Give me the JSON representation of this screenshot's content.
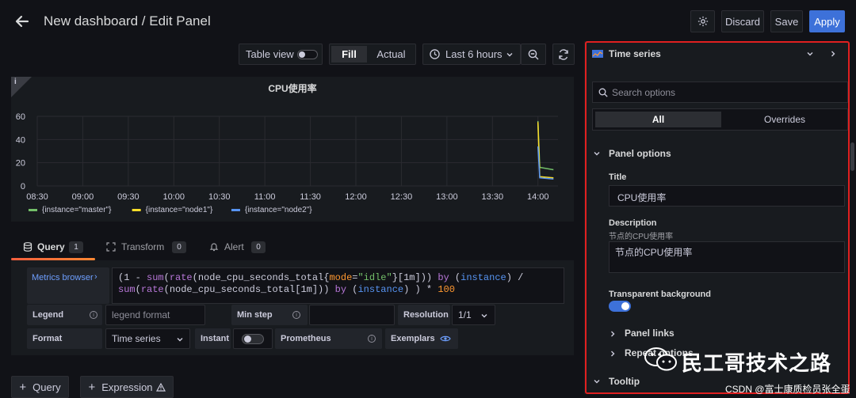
{
  "header": {
    "title": "New dashboard / Edit Panel",
    "discard": "Discard",
    "save": "Save",
    "apply": "Apply"
  },
  "toolbar": {
    "table_view": "Table view",
    "fill": "Fill",
    "actual": "Actual",
    "time_range": "Last 6 hours"
  },
  "panel": {
    "info_badge": "i",
    "title": "CPU使用率"
  },
  "chart_data": {
    "type": "line",
    "title": "CPU使用率",
    "x": [
      "08:30",
      "09:00",
      "09:30",
      "10:00",
      "10:30",
      "11:00",
      "11:30",
      "12:00",
      "12:30",
      "13:00",
      "13:30",
      "14:00"
    ],
    "yticks": [
      "0",
      "20",
      "40",
      "60"
    ],
    "ylim": [
      0,
      60
    ],
    "grid": true,
    "legend_position": "bottom-left",
    "series": [
      {
        "name": "{instance=\"master\"}",
        "color": "#73bf69",
        "points": [
          [
            14.0,
            56
          ],
          [
            14.02,
            16
          ],
          [
            14.17,
            14
          ]
        ]
      },
      {
        "name": "{instance=\"node1\"}",
        "color": "#fade2a",
        "points": [
          [
            14.0,
            55
          ],
          [
            14.02,
            8
          ],
          [
            14.17,
            7
          ]
        ]
      },
      {
        "name": "{instance=\"node2\"}",
        "color": "#5794f2",
        "points": [
          [
            14.0,
            34
          ],
          [
            14.02,
            7
          ],
          [
            14.17,
            6
          ]
        ]
      }
    ]
  },
  "tabs": [
    {
      "label": "Query",
      "count": "1"
    },
    {
      "label": "Transform",
      "count": "0"
    },
    {
      "label": "Alert",
      "count": "0"
    }
  ],
  "query": {
    "metrics_browser": "Metrics browser",
    "expr": [
      [
        [
          "(1 - ",
          "#ccccdc"
        ],
        [
          "sum",
          "#b877d9"
        ],
        [
          "(",
          "#ccccdc"
        ],
        [
          "rate",
          "#b877d9"
        ],
        [
          "(node_cpu_seconds_total{",
          "#ccccdc"
        ],
        [
          "mode",
          "#ff9830"
        ],
        [
          "=",
          "#ccccdc"
        ],
        [
          "\"idle\"",
          "#73bf69"
        ],
        [
          "}[1m])) ",
          "#ccccdc"
        ],
        [
          "by",
          "#b877d9"
        ],
        [
          " (",
          "#ccccdc"
        ],
        [
          "instance",
          "#5794f2"
        ],
        [
          ") /",
          "#ccccdc"
        ]
      ],
      [
        [
          "sum",
          "#b877d9"
        ],
        [
          "(",
          "#ccccdc"
        ],
        [
          "rate",
          "#b877d9"
        ],
        [
          "(node_cpu_seconds_total[1m])) ",
          "#ccccdc"
        ],
        [
          "by",
          "#b877d9"
        ],
        [
          " (",
          "#ccccdc"
        ],
        [
          "instance",
          "#5794f2"
        ],
        [
          ") ) * ",
          "#ccccdc"
        ],
        [
          "100",
          "#ff9830"
        ]
      ]
    ],
    "legend_label": "Legend",
    "legend_placeholder": "legend format",
    "min_step_label": "Min step",
    "resolution_label": "Resolution",
    "resolution_value": "1/1",
    "format_label": "Format",
    "format_value": "Time series",
    "instant_label": "Instant",
    "prometheus_label": "Prometheus",
    "exemplars_label": "Exemplars"
  },
  "bottom": {
    "add_query": "Query",
    "add_expression": "Expression"
  },
  "options": {
    "viz": "Time series",
    "search_placeholder": "Search options",
    "tab_all": "All",
    "tab_overrides": "Overrides",
    "section_panel": "Panel options",
    "title_label": "Title",
    "title_value": "CPU使用率",
    "description_label": "Description",
    "description_hint": "节点的CPU使用率",
    "description_value": "节点的CPU使用率",
    "transparent_label": "Transparent background",
    "panel_links": "Panel links",
    "repeat_options": "Repeat options",
    "tooltip": "Tooltip"
  },
  "watermark": {
    "brand": "民工哥技术之路",
    "credit": "CSDN @富士康质检员张全蛋"
  }
}
